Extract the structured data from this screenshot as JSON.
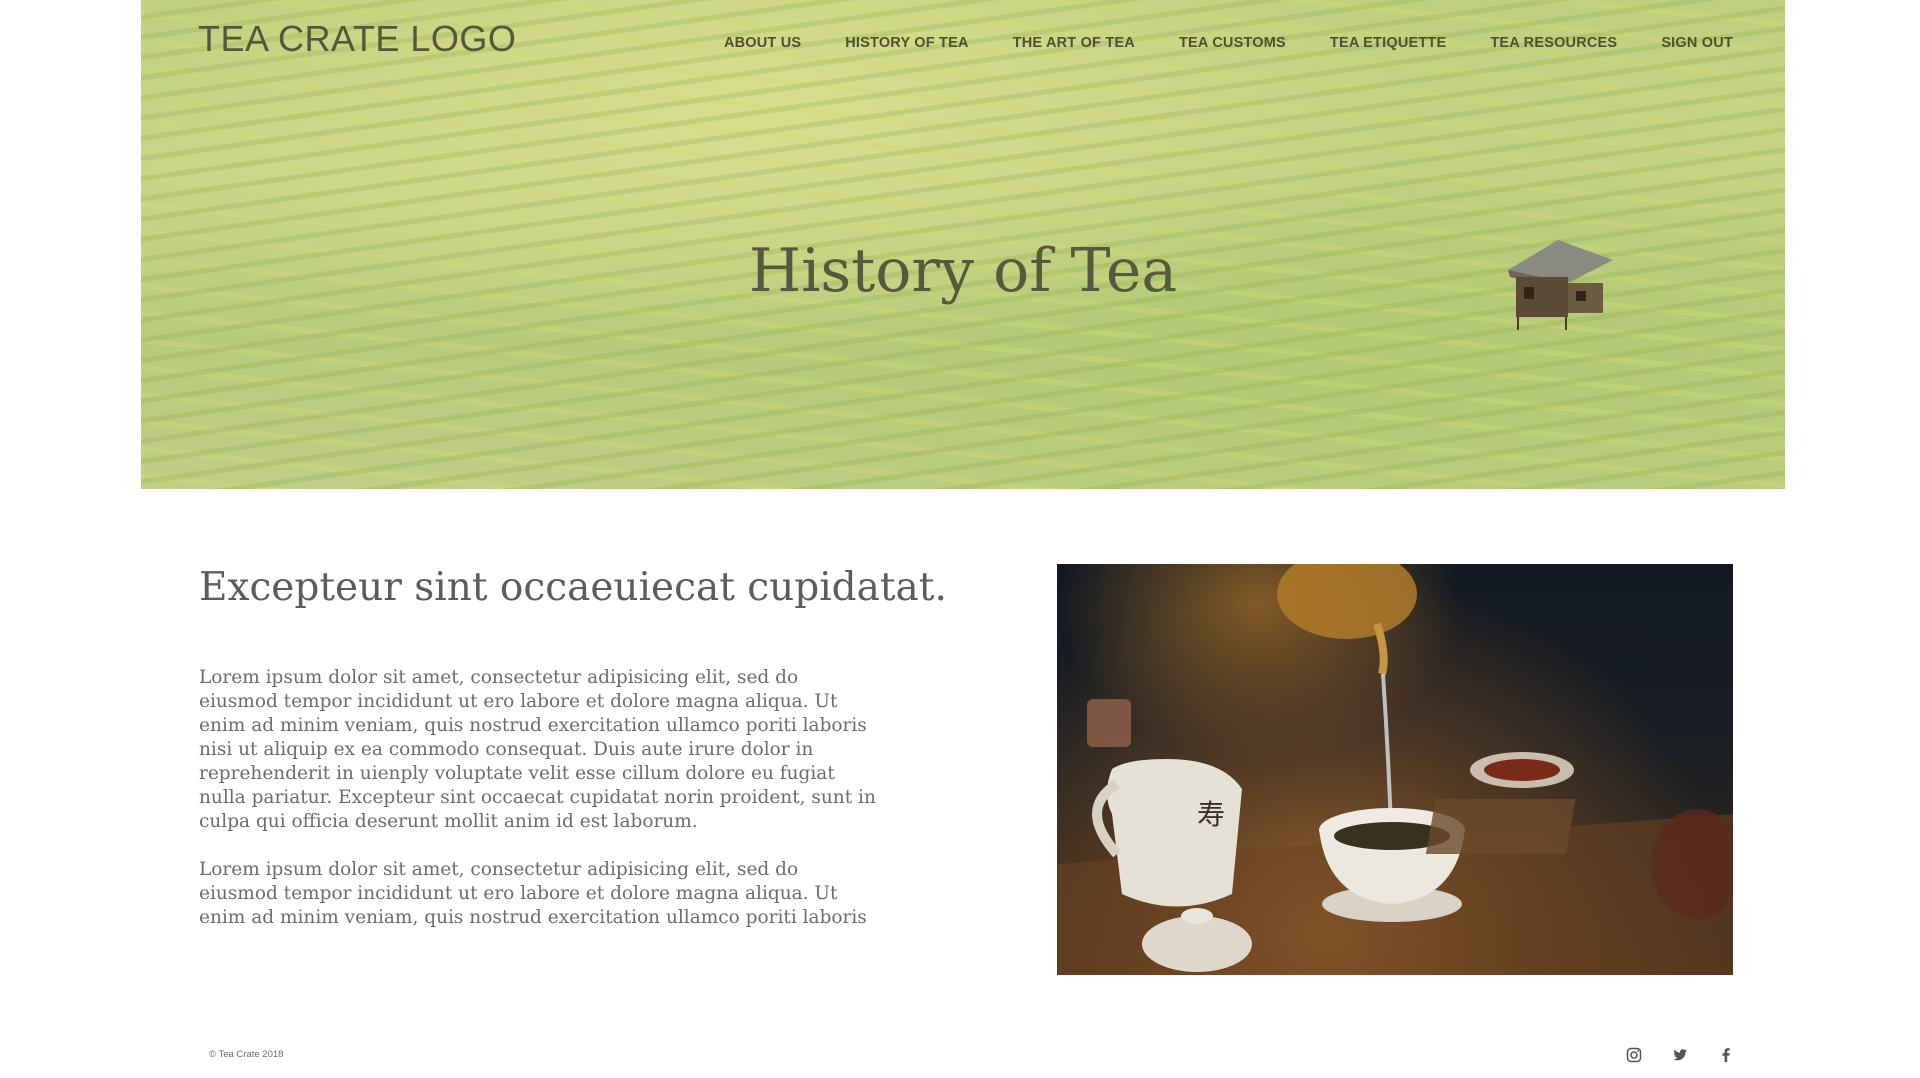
{
  "header": {
    "logo_text": "TEA CRATE LOGO",
    "nav": [
      {
        "label": "ABOUT US"
      },
      {
        "label": "HISTORY OF TEA"
      },
      {
        "label": "THE ART OF TEA"
      },
      {
        "label": "TEA CUSTOMS"
      },
      {
        "label": "TEA ETIQUETTE"
      },
      {
        "label": "TEA RESOURCES"
      },
      {
        "label": "SIGN OUT"
      }
    ]
  },
  "hero": {
    "title": "History of Tea"
  },
  "content": {
    "heading": "Excepteur sint occaeuiecat cupidatat.",
    "paragraphs": [
      "Lorem ipsum dolor sit amet, consectetur adipisicing elit, sed do eiusmod tempor incididunt ut ero labore et dolore magna aliqua. Ut enim ad minim veniam, quis nostrud exercitation ullamco poriti laboris nisi ut aliquip ex ea commodo consequat. Duis aute irure dolor in reprehenderit in uienply voluptate velit esse cillum dolore eu fugiat nulla pariatur. Excepteur sint occaecat cupidatat norin proident, sunt in culpa qui officia deserunt mollit anim id est laborum.",
      "Lorem ipsum dolor sit amet, consectetur adipisicing elit, sed do eiusmod tempor incididunt ut ero labore et dolore magna aliqua. Ut enim ad minim veniam, quis nostrud exercitation ullamco poriti laboris nisi ut aliquip ex ea"
    ]
  },
  "footer": {
    "copyright": "© Tea Crate 2018",
    "social": [
      "instagram-icon",
      "twitter-icon",
      "facebook-icon"
    ]
  },
  "colors": {
    "text_dark": "#55563a",
    "body_text": "#6a6d6f",
    "heading_text": "#5a5d60"
  }
}
